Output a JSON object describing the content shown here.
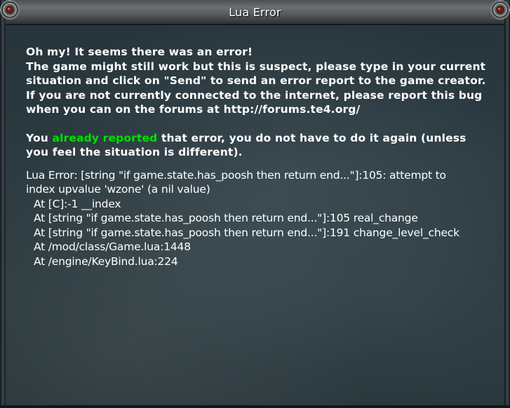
{
  "window": {
    "title": "Lua Error"
  },
  "message": {
    "line1": "Oh my! It seems there was an error!",
    "line2": "The game might still work but this is suspect, please type in your current",
    "line3": "situation and click on \"Send\" to send an error report to the game creator.",
    "line4": "If you are not currently connected to the internet, please report this bug",
    "line5": "when you can on the forums at http://forums.te4.org/"
  },
  "reported": {
    "prefix": "You ",
    "highlight": "already reported",
    "suffix": " that error, you do not have to do it again (unless",
    "line2": "you feel the situation is different).",
    "highlight_color": "#00e000"
  },
  "trace": {
    "error_line1": "Lua Error: [string \"if game.state.has_poosh then return end...\"]:105: attempt to",
    "error_line2": "index upvalue 'wzone' (a nil value)",
    "frames": [
      "At [C]:-1 __index",
      "At [string \"if game.state.has_poosh then return end...\"]:105 real_change",
      "At [string \"if game.state.has_poosh then return end...\"]:191 change_level_check",
      "At /mod/class/Game.lua:1448",
      "At /engine/KeyBind.lua:224"
    ]
  },
  "icons": {
    "corner_left": "gem-ornament-icon",
    "corner_right": "gem-ornament-icon"
  }
}
